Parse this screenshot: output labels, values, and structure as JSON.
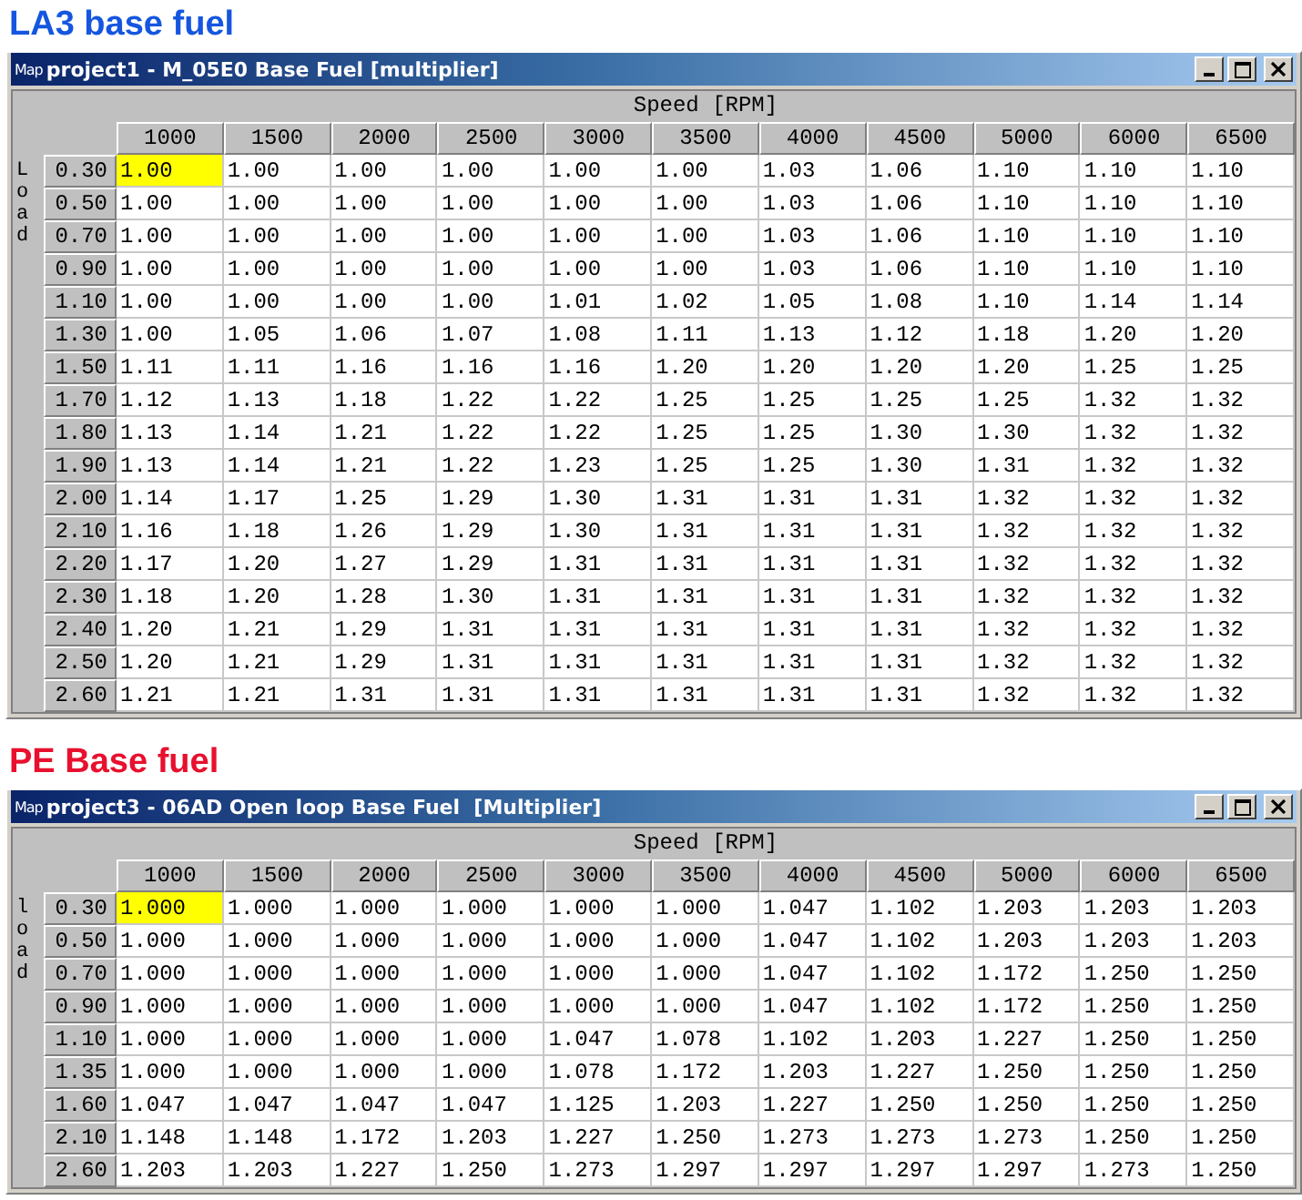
{
  "sections": [
    {
      "heading": "LA3 base fuel",
      "window": {
        "icon_text": "Map",
        "title": "project1 - M_05E0 Base Fuel [multiplier]"
      },
      "table": {
        "x_axis": "Speed [RPM]",
        "y_axis": "Load",
        "columns": [
          "1000",
          "1500",
          "2000",
          "2500",
          "3000",
          "3500",
          "4000",
          "4500",
          "5000",
          "6000",
          "6500"
        ],
        "rows": [
          {
            "label": "0.30",
            "cells": [
              {
                "value": "1.00",
                "selected": true
              },
              {
                "value": "1.00",
                "selected": false
              },
              {
                "value": "1.00",
                "selected": false
              },
              {
                "value": "1.00",
                "selected": false
              },
              {
                "value": "1.00",
                "selected": false
              },
              {
                "value": "1.00",
                "selected": false
              },
              {
                "value": "1.03",
                "selected": false
              },
              {
                "value": "1.06",
                "selected": false
              },
              {
                "value": "1.10",
                "selected": false
              },
              {
                "value": "1.10",
                "selected": false
              },
              {
                "value": "1.10",
                "selected": false
              }
            ]
          },
          {
            "label": "0.50",
            "cells": [
              {
                "value": "1.00",
                "selected": false
              },
              {
                "value": "1.00",
                "selected": false
              },
              {
                "value": "1.00",
                "selected": false
              },
              {
                "value": "1.00",
                "selected": false
              },
              {
                "value": "1.00",
                "selected": false
              },
              {
                "value": "1.00",
                "selected": false
              },
              {
                "value": "1.03",
                "selected": false
              },
              {
                "value": "1.06",
                "selected": false
              },
              {
                "value": "1.10",
                "selected": false
              },
              {
                "value": "1.10",
                "selected": false
              },
              {
                "value": "1.10",
                "selected": false
              }
            ]
          },
          {
            "label": "0.70",
            "cells": [
              {
                "value": "1.00",
                "selected": false
              },
              {
                "value": "1.00",
                "selected": false
              },
              {
                "value": "1.00",
                "selected": false
              },
              {
                "value": "1.00",
                "selected": false
              },
              {
                "value": "1.00",
                "selected": false
              },
              {
                "value": "1.00",
                "selected": false
              },
              {
                "value": "1.03",
                "selected": false
              },
              {
                "value": "1.06",
                "selected": false
              },
              {
                "value": "1.10",
                "selected": false
              },
              {
                "value": "1.10",
                "selected": false
              },
              {
                "value": "1.10",
                "selected": false
              }
            ]
          },
          {
            "label": "0.90",
            "cells": [
              {
                "value": "1.00",
                "selected": false
              },
              {
                "value": "1.00",
                "selected": false
              },
              {
                "value": "1.00",
                "selected": false
              },
              {
                "value": "1.00",
                "selected": false
              },
              {
                "value": "1.00",
                "selected": false
              },
              {
                "value": "1.00",
                "selected": false
              },
              {
                "value": "1.03",
                "selected": false
              },
              {
                "value": "1.06",
                "selected": false
              },
              {
                "value": "1.10",
                "selected": false
              },
              {
                "value": "1.10",
                "selected": false
              },
              {
                "value": "1.10",
                "selected": false
              }
            ]
          },
          {
            "label": "1.10",
            "cells": [
              {
                "value": "1.00",
                "selected": false
              },
              {
                "value": "1.00",
                "selected": false
              },
              {
                "value": "1.00",
                "selected": false
              },
              {
                "value": "1.00",
                "selected": false
              },
              {
                "value": "1.01",
                "selected": false
              },
              {
                "value": "1.02",
                "selected": false
              },
              {
                "value": "1.05",
                "selected": false
              },
              {
                "value": "1.08",
                "selected": false
              },
              {
                "value": "1.10",
                "selected": false
              },
              {
                "value": "1.14",
                "selected": false
              },
              {
                "value": "1.14",
                "selected": false
              }
            ]
          },
          {
            "label": "1.30",
            "cells": [
              {
                "value": "1.00",
                "selected": false
              },
              {
                "value": "1.05",
                "selected": false
              },
              {
                "value": "1.06",
                "selected": false
              },
              {
                "value": "1.07",
                "selected": false
              },
              {
                "value": "1.08",
                "selected": false
              },
              {
                "value": "1.11",
                "selected": false
              },
              {
                "value": "1.13",
                "selected": false
              },
              {
                "value": "1.12",
                "selected": false
              },
              {
                "value": "1.18",
                "selected": false
              },
              {
                "value": "1.20",
                "selected": false
              },
              {
                "value": "1.20",
                "selected": false
              }
            ]
          },
          {
            "label": "1.50",
            "cells": [
              {
                "value": "1.11",
                "selected": false
              },
              {
                "value": "1.11",
                "selected": false
              },
              {
                "value": "1.16",
                "selected": false
              },
              {
                "value": "1.16",
                "selected": false
              },
              {
                "value": "1.16",
                "selected": false
              },
              {
                "value": "1.20",
                "selected": false
              },
              {
                "value": "1.20",
                "selected": false
              },
              {
                "value": "1.20",
                "selected": false
              },
              {
                "value": "1.20",
                "selected": false
              },
              {
                "value": "1.25",
                "selected": false
              },
              {
                "value": "1.25",
                "selected": false
              }
            ]
          },
          {
            "label": "1.70",
            "cells": [
              {
                "value": "1.12",
                "selected": false
              },
              {
                "value": "1.13",
                "selected": false
              },
              {
                "value": "1.18",
                "selected": false
              },
              {
                "value": "1.22",
                "selected": false
              },
              {
                "value": "1.22",
                "selected": false
              },
              {
                "value": "1.25",
                "selected": false
              },
              {
                "value": "1.25",
                "selected": false
              },
              {
                "value": "1.25",
                "selected": false
              },
              {
                "value": "1.25",
                "selected": false
              },
              {
                "value": "1.32",
                "selected": false
              },
              {
                "value": "1.32",
                "selected": false
              }
            ]
          },
          {
            "label": "1.80",
            "cells": [
              {
                "value": "1.13",
                "selected": false
              },
              {
                "value": "1.14",
                "selected": false
              },
              {
                "value": "1.21",
                "selected": false
              },
              {
                "value": "1.22",
                "selected": false
              },
              {
                "value": "1.22",
                "selected": false
              },
              {
                "value": "1.25",
                "selected": false
              },
              {
                "value": "1.25",
                "selected": false
              },
              {
                "value": "1.30",
                "selected": false
              },
              {
                "value": "1.30",
                "selected": false
              },
              {
                "value": "1.32",
                "selected": false
              },
              {
                "value": "1.32",
                "selected": false
              }
            ]
          },
          {
            "label": "1.90",
            "cells": [
              {
                "value": "1.13",
                "selected": false
              },
              {
                "value": "1.14",
                "selected": false
              },
              {
                "value": "1.21",
                "selected": false
              },
              {
                "value": "1.22",
                "selected": false
              },
              {
                "value": "1.23",
                "selected": false
              },
              {
                "value": "1.25",
                "selected": false
              },
              {
                "value": "1.25",
                "selected": false
              },
              {
                "value": "1.30",
                "selected": false
              },
              {
                "value": "1.31",
                "selected": false
              },
              {
                "value": "1.32",
                "selected": false
              },
              {
                "value": "1.32",
                "selected": false
              }
            ]
          },
          {
            "label": "2.00",
            "cells": [
              {
                "value": "1.14",
                "selected": false
              },
              {
                "value": "1.17",
                "selected": false
              },
              {
                "value": "1.25",
                "selected": false
              },
              {
                "value": "1.29",
                "selected": false
              },
              {
                "value": "1.30",
                "selected": false
              },
              {
                "value": "1.31",
                "selected": false
              },
              {
                "value": "1.31",
                "selected": false
              },
              {
                "value": "1.31",
                "selected": false
              },
              {
                "value": "1.32",
                "selected": false
              },
              {
                "value": "1.32",
                "selected": false
              },
              {
                "value": "1.32",
                "selected": false
              }
            ]
          },
          {
            "label": "2.10",
            "cells": [
              {
                "value": "1.16",
                "selected": false
              },
              {
                "value": "1.18",
                "selected": false
              },
              {
                "value": "1.26",
                "selected": false
              },
              {
                "value": "1.29",
                "selected": false
              },
              {
                "value": "1.30",
                "selected": false
              },
              {
                "value": "1.31",
                "selected": false
              },
              {
                "value": "1.31",
                "selected": false
              },
              {
                "value": "1.31",
                "selected": false
              },
              {
                "value": "1.32",
                "selected": false
              },
              {
                "value": "1.32",
                "selected": false
              },
              {
                "value": "1.32",
                "selected": false
              }
            ]
          },
          {
            "label": "2.20",
            "cells": [
              {
                "value": "1.17",
                "selected": false
              },
              {
                "value": "1.20",
                "selected": false
              },
              {
                "value": "1.27",
                "selected": false
              },
              {
                "value": "1.29",
                "selected": false
              },
              {
                "value": "1.31",
                "selected": false
              },
              {
                "value": "1.31",
                "selected": false
              },
              {
                "value": "1.31",
                "selected": false
              },
              {
                "value": "1.31",
                "selected": false
              },
              {
                "value": "1.32",
                "selected": false
              },
              {
                "value": "1.32",
                "selected": false
              },
              {
                "value": "1.32",
                "selected": false
              }
            ]
          },
          {
            "label": "2.30",
            "cells": [
              {
                "value": "1.18",
                "selected": false
              },
              {
                "value": "1.20",
                "selected": false
              },
              {
                "value": "1.28",
                "selected": false
              },
              {
                "value": "1.30",
                "selected": false
              },
              {
                "value": "1.31",
                "selected": false
              },
              {
                "value": "1.31",
                "selected": false
              },
              {
                "value": "1.31",
                "selected": false
              },
              {
                "value": "1.31",
                "selected": false
              },
              {
                "value": "1.32",
                "selected": false
              },
              {
                "value": "1.32",
                "selected": false
              },
              {
                "value": "1.32",
                "selected": false
              }
            ]
          },
          {
            "label": "2.40",
            "cells": [
              {
                "value": "1.20",
                "selected": false
              },
              {
                "value": "1.21",
                "selected": false
              },
              {
                "value": "1.29",
                "selected": false
              },
              {
                "value": "1.31",
                "selected": false
              },
              {
                "value": "1.31",
                "selected": false
              },
              {
                "value": "1.31",
                "selected": false
              },
              {
                "value": "1.31",
                "selected": false
              },
              {
                "value": "1.31",
                "selected": false
              },
              {
                "value": "1.32",
                "selected": false
              },
              {
                "value": "1.32",
                "selected": false
              },
              {
                "value": "1.32",
                "selected": false
              }
            ]
          },
          {
            "label": "2.50",
            "cells": [
              {
                "value": "1.20",
                "selected": false
              },
              {
                "value": "1.21",
                "selected": false
              },
              {
                "value": "1.29",
                "selected": false
              },
              {
                "value": "1.31",
                "selected": false
              },
              {
                "value": "1.31",
                "selected": false
              },
              {
                "value": "1.31",
                "selected": false
              },
              {
                "value": "1.31",
                "selected": false
              },
              {
                "value": "1.31",
                "selected": false
              },
              {
                "value": "1.32",
                "selected": false
              },
              {
                "value": "1.32",
                "selected": false
              },
              {
                "value": "1.32",
                "selected": false
              }
            ]
          },
          {
            "label": "2.60",
            "cells": [
              {
                "value": "1.21",
                "selected": false
              },
              {
                "value": "1.21",
                "selected": false
              },
              {
                "value": "1.31",
                "selected": false
              },
              {
                "value": "1.31",
                "selected": false
              },
              {
                "value": "1.31",
                "selected": false
              },
              {
                "value": "1.31",
                "selected": false
              },
              {
                "value": "1.31",
                "selected": false
              },
              {
                "value": "1.31",
                "selected": false
              },
              {
                "value": "1.32",
                "selected": false
              },
              {
                "value": "1.32",
                "selected": false
              },
              {
                "value": "1.32",
                "selected": false
              }
            ]
          }
        ]
      }
    },
    {
      "heading": "PE Base fuel",
      "window": {
        "icon_text": "Map",
        "title": "project3 - 06AD Open loop Base Fuel  [Multiplier]"
      },
      "table": {
        "x_axis": "Speed [RPM]",
        "y_axis": "load",
        "columns": [
          "1000",
          "1500",
          "2000",
          "2500",
          "3000",
          "3500",
          "4000",
          "4500",
          "5000",
          "6000",
          "6500"
        ],
        "rows": [
          {
            "label": "0.30",
            "cells": [
              {
                "value": "1.000",
                "selected": true
              },
              {
                "value": "1.000",
                "selected": false
              },
              {
                "value": "1.000",
                "selected": false
              },
              {
                "value": "1.000",
                "selected": false
              },
              {
                "value": "1.000",
                "selected": false
              },
              {
                "value": "1.000",
                "selected": false
              },
              {
                "value": "1.047",
                "selected": false
              },
              {
                "value": "1.102",
                "selected": false
              },
              {
                "value": "1.203",
                "selected": false
              },
              {
                "value": "1.203",
                "selected": false
              },
              {
                "value": "1.203",
                "selected": false
              }
            ]
          },
          {
            "label": "0.50",
            "cells": [
              {
                "value": "1.000",
                "selected": false
              },
              {
                "value": "1.000",
                "selected": false
              },
              {
                "value": "1.000",
                "selected": false
              },
              {
                "value": "1.000",
                "selected": false
              },
              {
                "value": "1.000",
                "selected": false
              },
              {
                "value": "1.000",
                "selected": false
              },
              {
                "value": "1.047",
                "selected": false
              },
              {
                "value": "1.102",
                "selected": false
              },
              {
                "value": "1.203",
                "selected": false
              },
              {
                "value": "1.203",
                "selected": false
              },
              {
                "value": "1.203",
                "selected": false
              }
            ]
          },
          {
            "label": "0.70",
            "cells": [
              {
                "value": "1.000",
                "selected": false
              },
              {
                "value": "1.000",
                "selected": false
              },
              {
                "value": "1.000",
                "selected": false
              },
              {
                "value": "1.000",
                "selected": false
              },
              {
                "value": "1.000",
                "selected": false
              },
              {
                "value": "1.000",
                "selected": false
              },
              {
                "value": "1.047",
                "selected": false
              },
              {
                "value": "1.102",
                "selected": false
              },
              {
                "value": "1.172",
                "selected": false
              },
              {
                "value": "1.250",
                "selected": false
              },
              {
                "value": "1.250",
                "selected": false
              }
            ]
          },
          {
            "label": "0.90",
            "cells": [
              {
                "value": "1.000",
                "selected": false
              },
              {
                "value": "1.000",
                "selected": false
              },
              {
                "value": "1.000",
                "selected": false
              },
              {
                "value": "1.000",
                "selected": false
              },
              {
                "value": "1.000",
                "selected": false
              },
              {
                "value": "1.000",
                "selected": false
              },
              {
                "value": "1.047",
                "selected": false
              },
              {
                "value": "1.102",
                "selected": false
              },
              {
                "value": "1.172",
                "selected": false
              },
              {
                "value": "1.250",
                "selected": false
              },
              {
                "value": "1.250",
                "selected": false
              }
            ]
          },
          {
            "label": "1.10",
            "cells": [
              {
                "value": "1.000",
                "selected": false
              },
              {
                "value": "1.000",
                "selected": false
              },
              {
                "value": "1.000",
                "selected": false
              },
              {
                "value": "1.000",
                "selected": false
              },
              {
                "value": "1.047",
                "selected": false
              },
              {
                "value": "1.078",
                "selected": false
              },
              {
                "value": "1.102",
                "selected": false
              },
              {
                "value": "1.203",
                "selected": false
              },
              {
                "value": "1.227",
                "selected": false
              },
              {
                "value": "1.250",
                "selected": false
              },
              {
                "value": "1.250",
                "selected": false
              }
            ]
          },
          {
            "label": "1.35",
            "cells": [
              {
                "value": "1.000",
                "selected": false
              },
              {
                "value": "1.000",
                "selected": false
              },
              {
                "value": "1.000",
                "selected": false
              },
              {
                "value": "1.000",
                "selected": false
              },
              {
                "value": "1.078",
                "selected": false
              },
              {
                "value": "1.172",
                "selected": false
              },
              {
                "value": "1.203",
                "selected": false
              },
              {
                "value": "1.227",
                "selected": false
              },
              {
                "value": "1.250",
                "selected": false
              },
              {
                "value": "1.250",
                "selected": false
              },
              {
                "value": "1.250",
                "selected": false
              }
            ]
          },
          {
            "label": "1.60",
            "cells": [
              {
                "value": "1.047",
                "selected": false
              },
              {
                "value": "1.047",
                "selected": false
              },
              {
                "value": "1.047",
                "selected": false
              },
              {
                "value": "1.047",
                "selected": false
              },
              {
                "value": "1.125",
                "selected": false
              },
              {
                "value": "1.203",
                "selected": false
              },
              {
                "value": "1.227",
                "selected": false
              },
              {
                "value": "1.250",
                "selected": false
              },
              {
                "value": "1.250",
                "selected": false
              },
              {
                "value": "1.250",
                "selected": false
              },
              {
                "value": "1.250",
                "selected": false
              }
            ]
          },
          {
            "label": "2.10",
            "cells": [
              {
                "value": "1.148",
                "selected": false
              },
              {
                "value": "1.148",
                "selected": false
              },
              {
                "value": "1.172",
                "selected": false
              },
              {
                "value": "1.203",
                "selected": false
              },
              {
                "value": "1.227",
                "selected": false
              },
              {
                "value": "1.250",
                "selected": false
              },
              {
                "value": "1.273",
                "selected": false
              },
              {
                "value": "1.273",
                "selected": false
              },
              {
                "value": "1.273",
                "selected": false
              },
              {
                "value": "1.250",
                "selected": false
              },
              {
                "value": "1.250",
                "selected": false
              }
            ]
          },
          {
            "label": "2.60",
            "cells": [
              {
                "value": "1.203",
                "selected": false
              },
              {
                "value": "1.203",
                "selected": false
              },
              {
                "value": "1.227",
                "selected": false
              },
              {
                "value": "1.250",
                "selected": false
              },
              {
                "value": "1.273",
                "selected": false
              },
              {
                "value": "1.297",
                "selected": false
              },
              {
                "value": "1.297",
                "selected": false
              },
              {
                "value": "1.297",
                "selected": false
              },
              {
                "value": "1.297",
                "selected": false
              },
              {
                "value": "1.273",
                "selected": false
              },
              {
                "value": "1.250",
                "selected": false
              }
            ]
          }
        ]
      }
    }
  ]
}
